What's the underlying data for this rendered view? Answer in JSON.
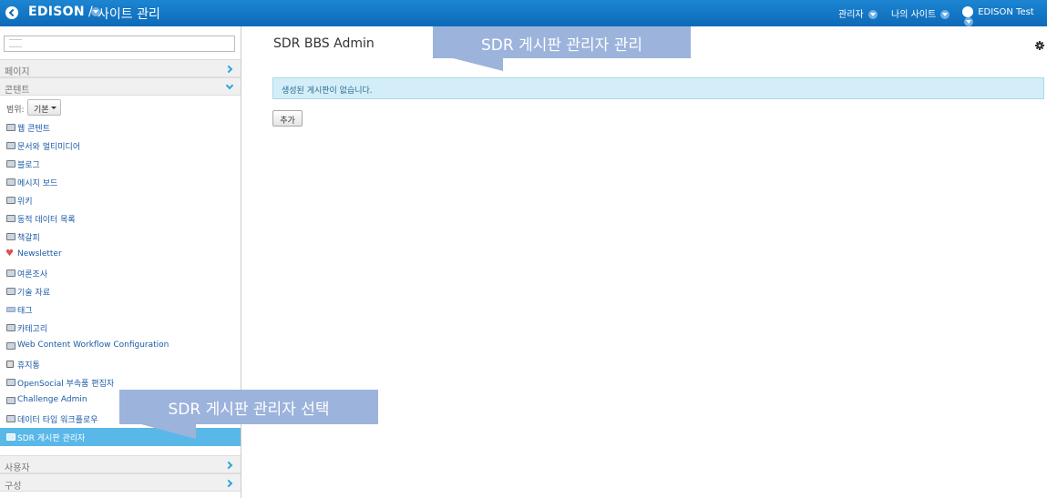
{
  "topbar": {
    "brand": "EDISON",
    "separator": "/",
    "section": "사이트 관리",
    "admin_menu": "관리자",
    "my_sites": "나의 사이트",
    "user_name": "EDISON Test"
  },
  "sidebar": {
    "search_placeholder": "",
    "sections": {
      "pages": "페이지",
      "content": "콘텐트",
      "users": "사용자",
      "configuration": "구성"
    },
    "scope_label": "범위:",
    "scope_value": "기본",
    "items": [
      {
        "label": "웹 콘텐트",
        "icon": "web-content-icon"
      },
      {
        "label": "문서와 멀티미디어",
        "icon": "documents-icon"
      },
      {
        "label": "블로그",
        "icon": "blog-icon"
      },
      {
        "label": "메시지 보드",
        "icon": "message-board-icon"
      },
      {
        "label": "위키",
        "icon": "wiki-icon"
      },
      {
        "label": "동적 데이터 목록",
        "icon": "dynamic-data-icon"
      },
      {
        "label": "책갈피",
        "icon": "bookmarks-icon"
      },
      {
        "label": "Newsletter",
        "icon": "newsletter-icon"
      },
      {
        "label": "여론조사",
        "icon": "polls-icon"
      },
      {
        "label": "기술 자료",
        "icon": "knowledge-base-icon"
      },
      {
        "label": "태그",
        "icon": "tags-icon"
      },
      {
        "label": "카테고리",
        "icon": "categories-icon"
      },
      {
        "label": "Web Content Workflow Configuration",
        "icon": "workflow-icon"
      },
      {
        "label": "휴지통",
        "icon": "trash-icon"
      },
      {
        "label": "OpenSocial 부속품 편집자",
        "icon": "opensocial-icon"
      },
      {
        "label": "Challenge Admin",
        "icon": "challenge-admin-icon"
      },
      {
        "label": "데이터 타입 워크플로우",
        "icon": "data-type-workflow-icon"
      },
      {
        "label": "SDR 게시판 관리자",
        "icon": "sdr-board-icon",
        "active": true
      }
    ]
  },
  "main": {
    "title": "SDR BBS Admin",
    "info_message": "생성된 게시판이 없습니다.",
    "add_button": "추가"
  },
  "callouts": {
    "top": "SDR 게시판 관리자 관리",
    "sidebar": "SDR 게시판 관리자 선택"
  },
  "colors": {
    "topbar": "#0d6ab8",
    "active_item": "#5ab8e8",
    "callout": "#9cb3dc",
    "info_bg": "#d3eef8"
  }
}
